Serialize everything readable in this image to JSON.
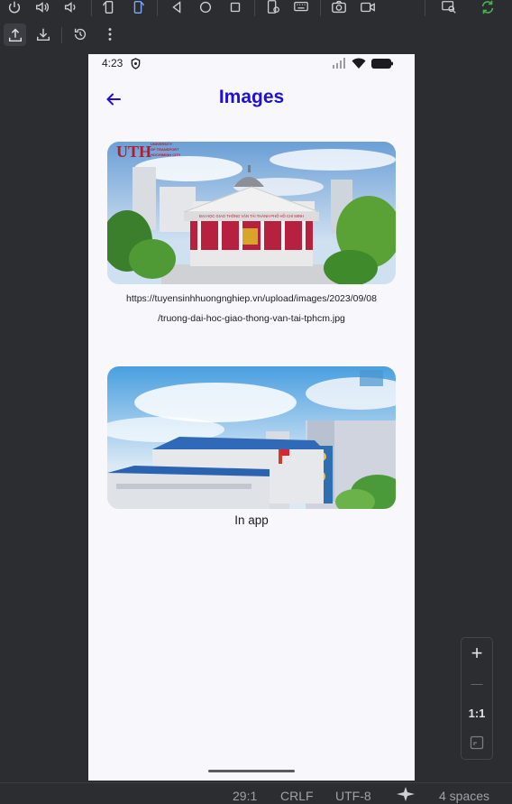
{
  "toolbar": {
    "row1_icons": [
      "power-icon",
      "volume-up-icon",
      "volume-down-icon",
      "rotate-left-icon",
      "rotate-right-icon",
      "back-icon",
      "home-icon",
      "overview-icon",
      "device-settings-icon",
      "keyboard-icon",
      "camera-icon",
      "video-icon",
      "zoom-inspect-icon",
      "sync-icon"
    ],
    "row2_icons": [
      "upload-icon",
      "download-icon",
      "reset-icon",
      "more-icon"
    ],
    "sync_color": "#4caf50"
  },
  "phone": {
    "status": {
      "time": "4:23"
    },
    "appbar": {
      "title": "Images",
      "accent": "#1f10d9"
    },
    "images": [
      {
        "caption_line1": "https://tuyensinhhuongnghiep.vn/upload/images/2023/09/08",
        "caption_line2": "/truong-dai-hoc-giao-thong-van-tai-tphcm.jpg"
      },
      {
        "caption": "In app"
      }
    ],
    "image1_text": {
      "logo_letters": "UTH",
      "logo_lines": [
        "UNIVERSITY",
        "OF TRANSPORT",
        "HOCHIMINH CITY"
      ],
      "banner": "ĐẠI HỌC GIAO THÔNG VẬN TẢI THÀNH PHỐ HỒ CHÍ MINH"
    }
  },
  "zoom": {
    "plus": "+",
    "minus": "—",
    "one_to_one": "1:1"
  },
  "ide_status": {
    "position": "29:1",
    "line_ending": "CRLF",
    "encoding": "UTF-8",
    "indent": "4 spaces"
  }
}
